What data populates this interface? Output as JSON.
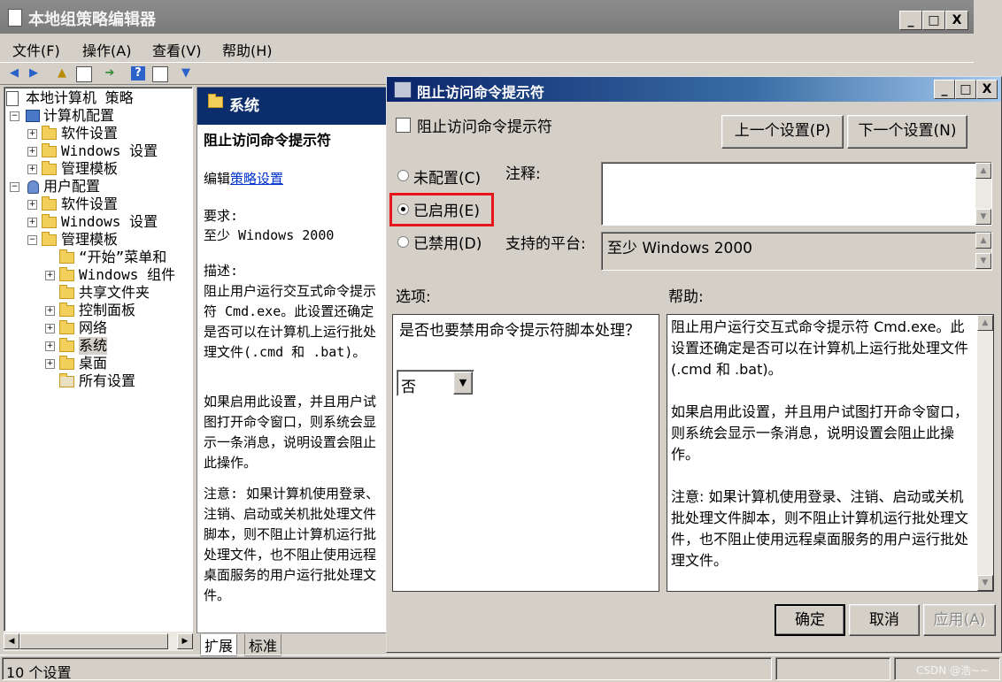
{
  "main_window": {
    "title": "本地组策略编辑器",
    "controls": {
      "minimize": "_",
      "maximize": "□",
      "close": "X"
    }
  },
  "menu": [
    "文件(F)",
    "操作(A)",
    "查看(V)",
    "帮助(H)"
  ],
  "tree": {
    "items": [
      {
        "label": "本地计算机 策略",
        "expander": ""
      },
      {
        "label": "计算机配置",
        "expander": "⊟"
      },
      {
        "label": "软件设置",
        "expander": "+"
      },
      {
        "label": "Windows 设置",
        "expander": "+"
      },
      {
        "label": "管理模板",
        "expander": "+"
      },
      {
        "label": "用户配置",
        "expander": "⊟"
      },
      {
        "label": "软件设置",
        "expander": "+"
      },
      {
        "label": "Windows 设置",
        "expander": "+"
      },
      {
        "label": "管理模板",
        "expander": "−"
      },
      {
        "label": "“开始”菜单和",
        "expander": ""
      },
      {
        "label": "Windows 组件",
        "expander": "+"
      },
      {
        "label": "共享文件夹",
        "expander": ""
      },
      {
        "label": "控制面板",
        "expander": "+"
      },
      {
        "label": "网络",
        "expander": "+"
      },
      {
        "label": "系统",
        "expander": "+"
      },
      {
        "label": "桌面",
        "expander": "+"
      },
      {
        "label": "所有设置",
        "expander": ""
      }
    ]
  },
  "description_pane": {
    "header": "系统",
    "title": "阻止访问命令提示符",
    "edit_prefix": "编辑",
    "edit_link": "策略设置",
    "requirements_label": "要求:",
    "requirements_value": "至少 Windows 2000",
    "desc_label": "描述:",
    "desc_body": "阻止用户运行交互式命令提示符 Cmd.exe。此设置还确定是否可以在计算机上运行批处理文件(.cmd 和 .bat)。",
    "desc_p2": "如果启用此设置，并且用户试图打开命令窗口，则系统会显示一条消息，说明设置会阻止此操作。",
    "desc_p3": "注意: 如果计算机使用登录、注销、启动或关机批处理文件脚本，则不阻止计算机运行批处理文件，也不阻止使用远程桌面服务的用户运行批处理文件。"
  },
  "tabs": [
    "扩展",
    "标准"
  ],
  "status": {
    "text": "10 个设置",
    "watermark": "CSDN @浩~~"
  },
  "dialog": {
    "title": "阻止访问命令提示符",
    "setting_name": "阻止访问命令提示符",
    "prev_button": "上一个设置(P)",
    "next_button": "下一个设置(N)",
    "radio_not_configured": "未配置(C)",
    "radio_enabled": "已启用(E)",
    "radio_disabled": "已禁用(D)",
    "selected": "enabled",
    "comment_label": "注释:",
    "comment_value": "",
    "platform_label": "支持的平台:",
    "platform_value": "至少 Windows 2000",
    "options_label": "选项:",
    "help_label": "帮助:",
    "option_question": "是否也要禁用命令提示符脚本处理？",
    "option_value": "否",
    "help_p1": "阻止用户运行交互式命令提示符 Cmd.exe。此设置还确定是否可以在计算机上运行批处理文件(.cmd 和 .bat)。",
    "help_p2": "如果启用此设置，并且用户试图打开命令窗口，则系统会显示一条消息，说明设置会阻止此操作。",
    "help_p3": "注意: 如果计算机使用登录、注销、启动或关机批处理文件脚本，则不阻止计算机运行批处理文件，也不阻止使用远程桌面服务的用户运行批处理文件。",
    "ok": "确定",
    "cancel": "取消",
    "apply": "应用(A)"
  },
  "colors": {
    "highlight": "#e8141c",
    "desc_header_bg": "#0b2d6b",
    "title_active": "#0a246a"
  }
}
